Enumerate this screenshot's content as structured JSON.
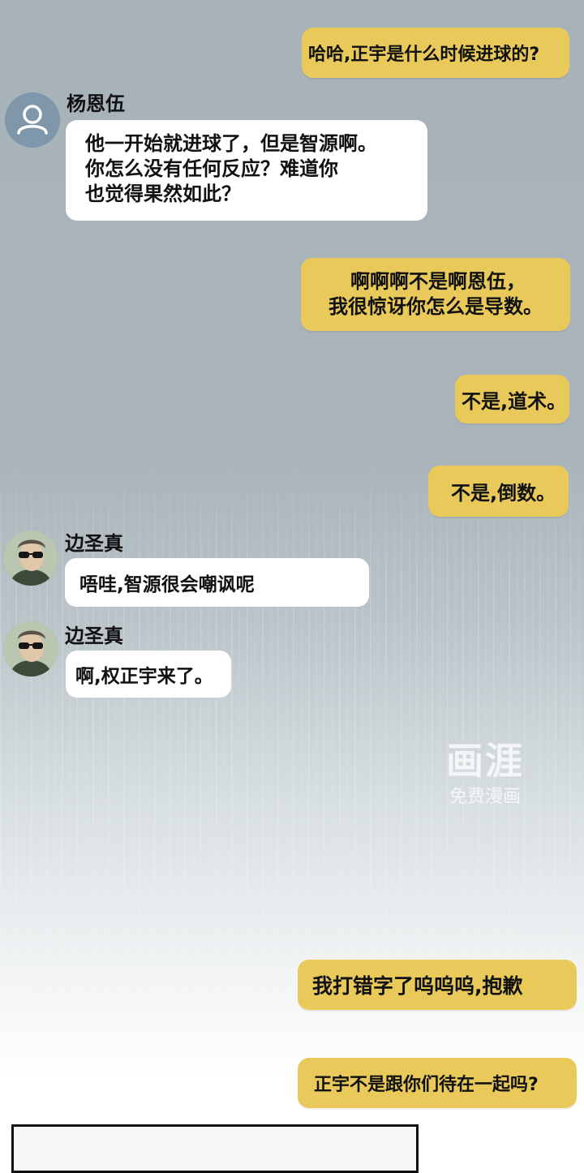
{
  "messages": [
    {
      "side": "me",
      "text": "哈哈,正宇是什么时候进球的?"
    },
    {
      "side": "them",
      "sender": "杨恩伍",
      "lines": [
        "他一开始就进球了，但是智源啊。",
        "你怎么没有任何反应？难道你",
        "也觉得果然如此？"
      ]
    },
    {
      "side": "me",
      "lines": [
        "啊啊啊不是啊恩伍，",
        "我很惊讶你怎么是导数。"
      ]
    },
    {
      "side": "me",
      "text": "不是,道术。"
    },
    {
      "side": "me",
      "text": "不是,倒数。"
    },
    {
      "side": "them",
      "sender": "边圣真",
      "text": "唔哇,智源很会嘲讽呢"
    },
    {
      "side": "them",
      "sender": "边圣真",
      "text": "啊,权正宇来了。"
    },
    {
      "side": "me",
      "text": "我打错字了呜呜呜,抱歉"
    },
    {
      "side": "me",
      "text": "正宇不是跟你们待在一起吗?"
    }
  ],
  "watermark": {
    "logo": "画涯",
    "caption": "免费漫画"
  },
  "colors": {
    "my_bubble": "#e8c95a",
    "their_bubble": "#ffffff",
    "background_top": "#a8b3b9",
    "background_bottom": "#ffffff"
  },
  "icons": {
    "default_avatar": "user-silhouette-icon",
    "character_avatar": "sunglasses-man-avatar"
  }
}
